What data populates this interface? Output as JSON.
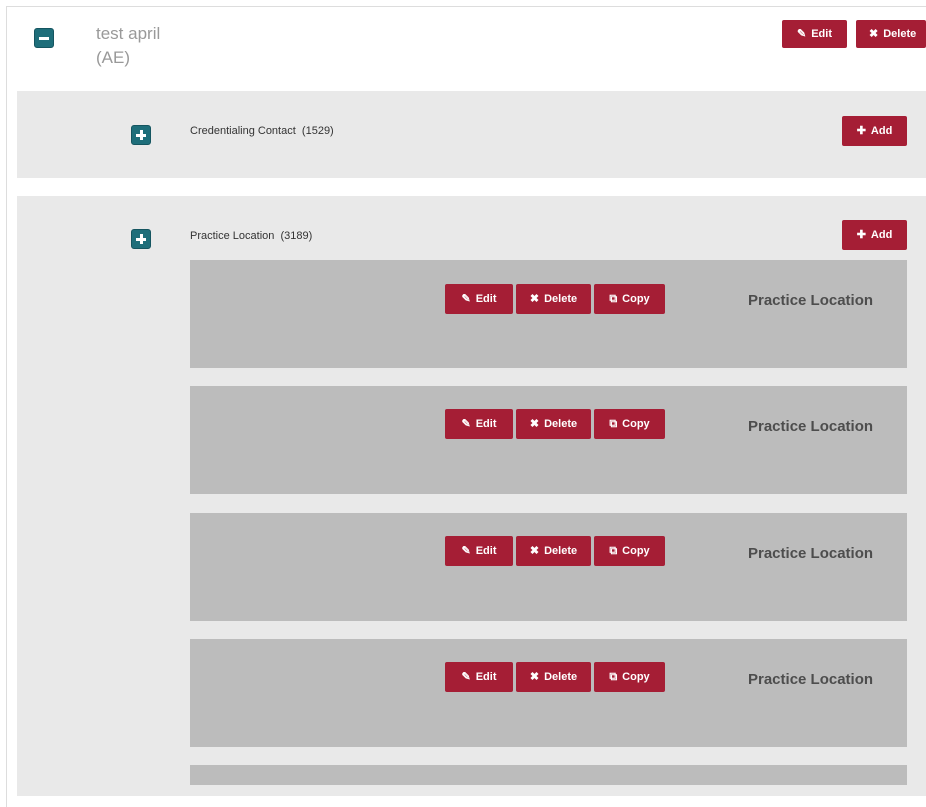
{
  "root": {
    "title_line1": "test april",
    "title_line2": "(AE)",
    "edit_label": "Edit",
    "delete_label": "Delete"
  },
  "sections": [
    {
      "label": "Credentialing Contact",
      "count": "(1529)",
      "add_label": "Add"
    },
    {
      "label": "Practice Location",
      "count": "(3189)",
      "add_label": "Add"
    }
  ],
  "cards": [
    {
      "title": "Practice Location",
      "edit": "Edit",
      "delete": "Delete",
      "copy": "Copy"
    },
    {
      "title": "Practice Location",
      "edit": "Edit",
      "delete": "Delete",
      "copy": "Copy"
    },
    {
      "title": "Practice Location",
      "edit": "Edit",
      "delete": "Delete",
      "copy": "Copy"
    },
    {
      "title": "Practice Location",
      "edit": "Edit",
      "delete": "Delete",
      "copy": "Copy"
    }
  ],
  "icons": {
    "edit": "edit-icon",
    "delete": "x-icon",
    "copy": "copy-icon",
    "add": "plus-icon",
    "collapse": "minus-icon",
    "expand": "plus-icon"
  },
  "colors": {
    "accent": "#a51e35",
    "toggle": "#1e6e7a",
    "panel": "#e9e9e9",
    "card": "#bcbcbc"
  }
}
